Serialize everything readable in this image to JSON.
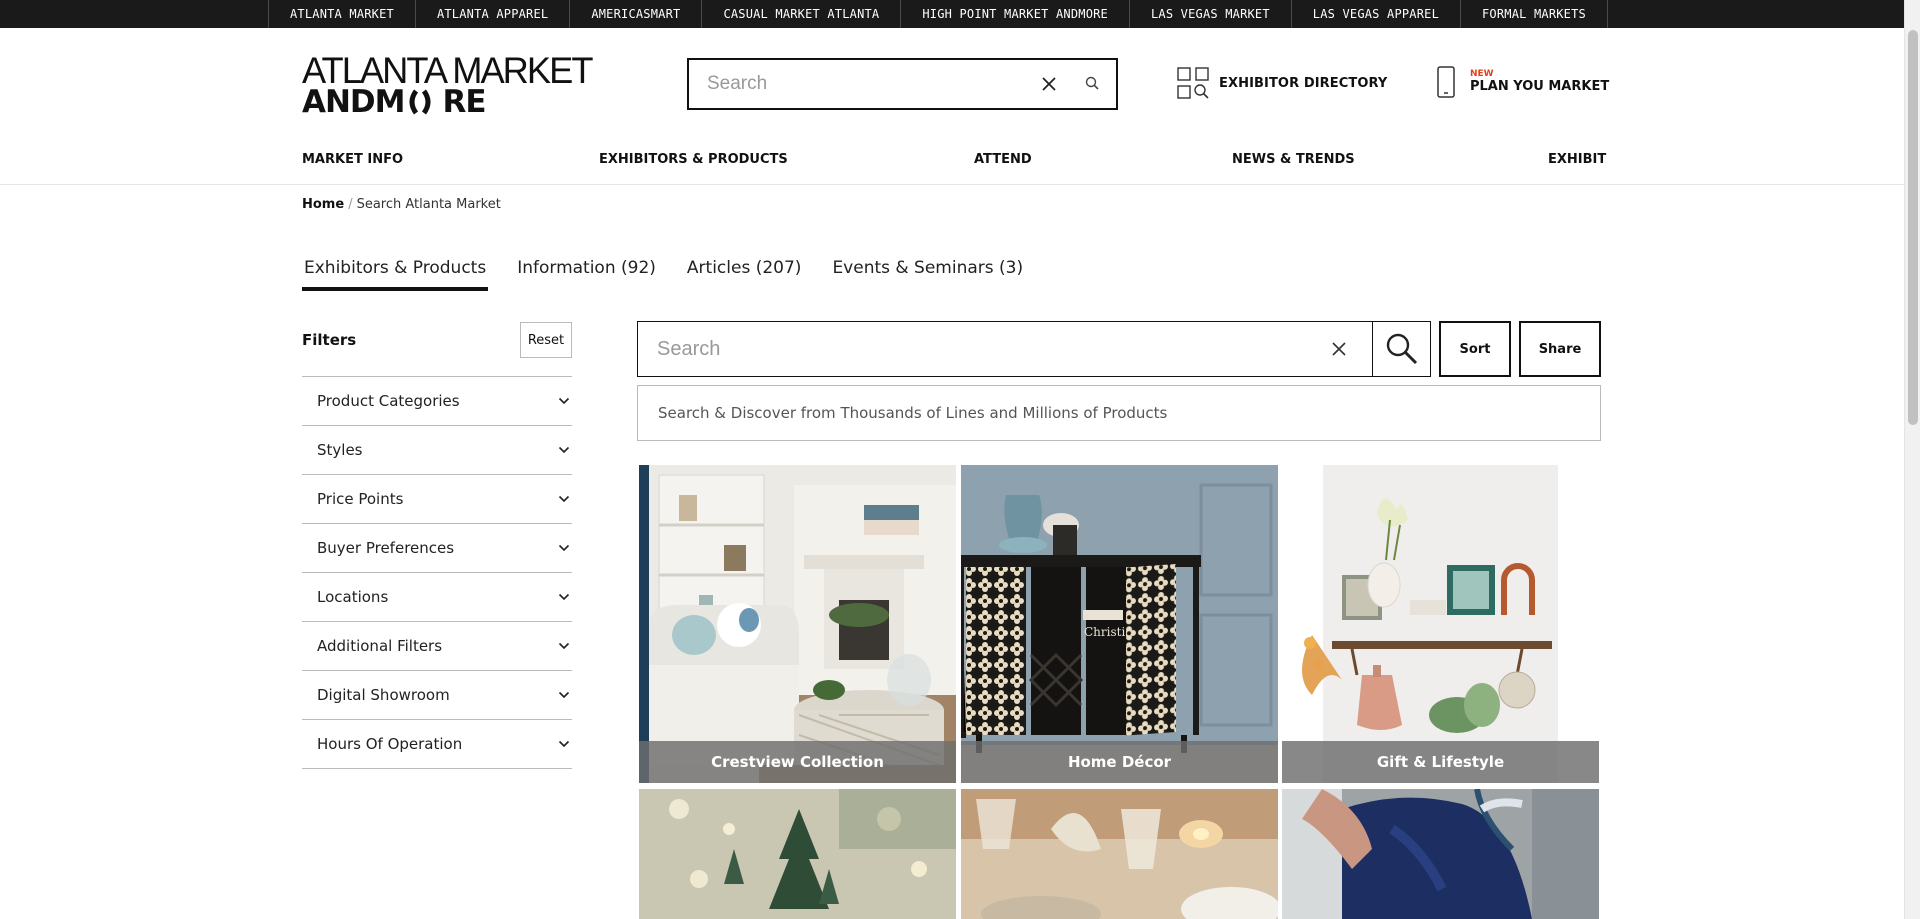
{
  "topbar": {
    "items": [
      "ATLANTA MARKET",
      "ATLANTA APPAREL",
      "AMERICASMART",
      "CASUAL MARKET ATLANTA",
      "HIGH POINT MARKET ANDMORE",
      "LAS VEGAS MARKET",
      "LAS VEGAS APPAREL",
      "FORMAL MARKETS"
    ]
  },
  "logo": {
    "line1": "ATLANTA MARKET",
    "line2_left": "ANDM",
    "line2_right": "RE"
  },
  "header": {
    "search_placeholder": "Search",
    "exhibitor_directory": "EXHIBITOR DIRECTORY",
    "plan_badge": "NEW",
    "plan_label": "PLAN YOU MARKET"
  },
  "nav": {
    "items": [
      "MARKET INFO",
      "EXHIBITORS & PRODUCTS",
      "ATTEND",
      "NEWS & TRENDS",
      "EXHIBIT"
    ]
  },
  "breadcrumb": {
    "home": "Home",
    "separator": "/",
    "current": "Search Atlanta Market"
  },
  "tabs": [
    "Exhibitors & Products",
    "Information (92)",
    "Articles (207)",
    "Events & Seminars (3)"
  ],
  "filters": {
    "title": "Filters",
    "reset": "Reset",
    "items": [
      "Product Categories",
      "Styles",
      "Price Points",
      "Buyer Preferences",
      "Locations",
      "Additional Filters",
      "Digital Showroom",
      "Hours Of Operation"
    ]
  },
  "search": {
    "placeholder": "Search",
    "sort": "Sort",
    "share": "Share",
    "discover_text": "Search & Discover from Thousands of Lines and Millions of Products"
  },
  "tiles": {
    "captions": [
      "Crestview Collection",
      "Home Décor",
      "Gift & Lifestyle"
    ],
    "cabinet_text": "Christi"
  },
  "colors": {
    "topbar_bg": "#1a1a1a",
    "new_badge": "#e0411b",
    "caption_overlay": "#6e6e6e"
  }
}
